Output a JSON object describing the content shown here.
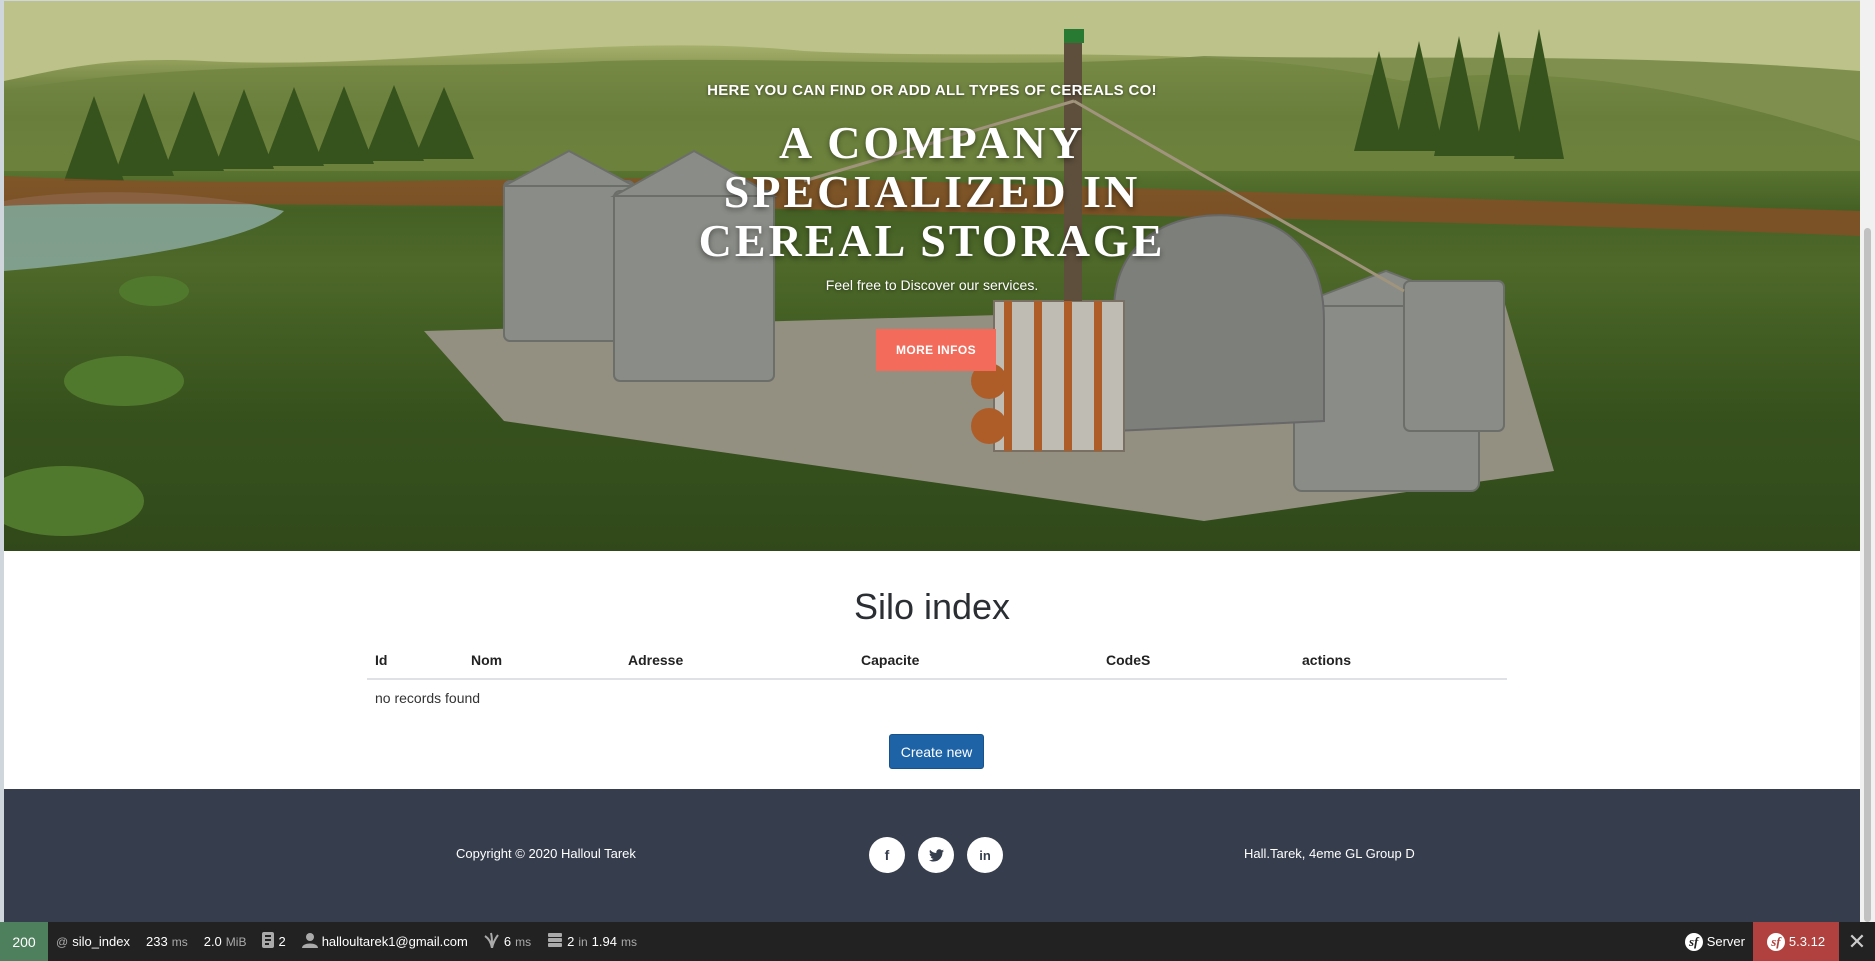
{
  "hero": {
    "eyebrow": "HERE YOU CAN FIND OR ADD ALL TYPES OF CEREALS CO!",
    "title_lines": [
      "A COMPANY",
      "SPECIALIZED IN",
      "CEREAL STORAGE"
    ],
    "subtitle": "Feel free to Discover our services.",
    "button_label": "MORE INFOS",
    "button_color": "#f26b5b"
  },
  "main": {
    "title": "Silo index",
    "columns": [
      "Id",
      "Nom",
      "Adresse",
      "Capacite",
      "CodeS",
      "actions"
    ],
    "empty_message": "no records found",
    "create_label": "Create new"
  },
  "footer": {
    "copyright": "Copyright © 2020 Halloul Tarek",
    "address": "Hall.Tarek, 4eme GL Group D",
    "social": [
      "facebook-icon",
      "twitter-icon",
      "linkedin-icon"
    ],
    "background": "#363d4d"
  },
  "toolbar": {
    "status_code": "200",
    "route": "silo_index",
    "time_value": "233",
    "time_unit": "ms",
    "memory_value": "2.0",
    "memory_unit": "MiB",
    "forms_count": "2",
    "user": "halloultarek1@gmail.com",
    "twig_time": "6",
    "twig_unit": "ms",
    "db_queries": "2",
    "db_in": "in",
    "db_time": "1.94",
    "db_unit": "ms",
    "server_label": "Server",
    "version": "5.3.12"
  }
}
